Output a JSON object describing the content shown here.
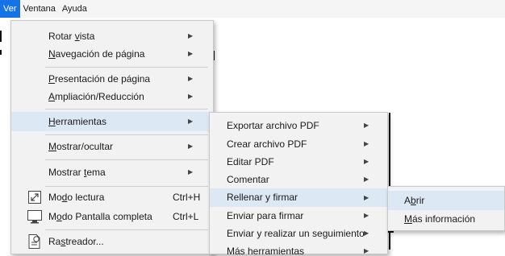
{
  "menubar": {
    "items": [
      "Ver",
      "Ventana",
      "Ayuda"
    ]
  },
  "ver_menu": {
    "rotate": {
      "label": "Rotar vista",
      "mnemonic": "v"
    },
    "page_nav": {
      "label": "Navegación de página",
      "mnemonic": "N"
    },
    "page_display": {
      "label": "Presentación de página",
      "mnemonic": "P"
    },
    "zoom": {
      "label": "Ampliación/Reducción",
      "mnemonic": "A"
    },
    "tools": {
      "label": "Herramientas",
      "mnemonic": "H"
    },
    "show_hide": {
      "label": "Mostrar/ocultar",
      "mnemonic": "M"
    },
    "show_theme": {
      "label": "Mostrar tema",
      "mnemonic": "t"
    },
    "read_mode": {
      "label": "Modo lectura",
      "mnemonic": "d",
      "shortcut": "Ctrl+H",
      "icon": "read-mode-icon"
    },
    "full_screen": {
      "label": "Modo Pantalla completa",
      "mnemonic": "o",
      "shortcut": "Ctrl+L",
      "icon": "full-screen-icon"
    },
    "tracker": {
      "label": "Rastreador...",
      "mnemonic": "s",
      "icon": "tracker-icon"
    }
  },
  "tools_submenu": {
    "items": [
      "Exportar archivo PDF",
      "Crear archivo PDF",
      "Editar PDF",
      "Comentar",
      "Rellenar y firmar",
      "Enviar para firmar",
      "Enviar y realizar un seguimiento",
      "Más herramientas"
    ]
  },
  "fill_sign_submenu": {
    "open": {
      "label": "Abrir",
      "mnemonic": "b"
    },
    "more_info": {
      "label": "Más información",
      "mnemonic": "M"
    }
  },
  "colors": {
    "menubar_active": "#1473e6",
    "menu_bg": "#f2f2f2",
    "highlight": "#dde8f5"
  }
}
